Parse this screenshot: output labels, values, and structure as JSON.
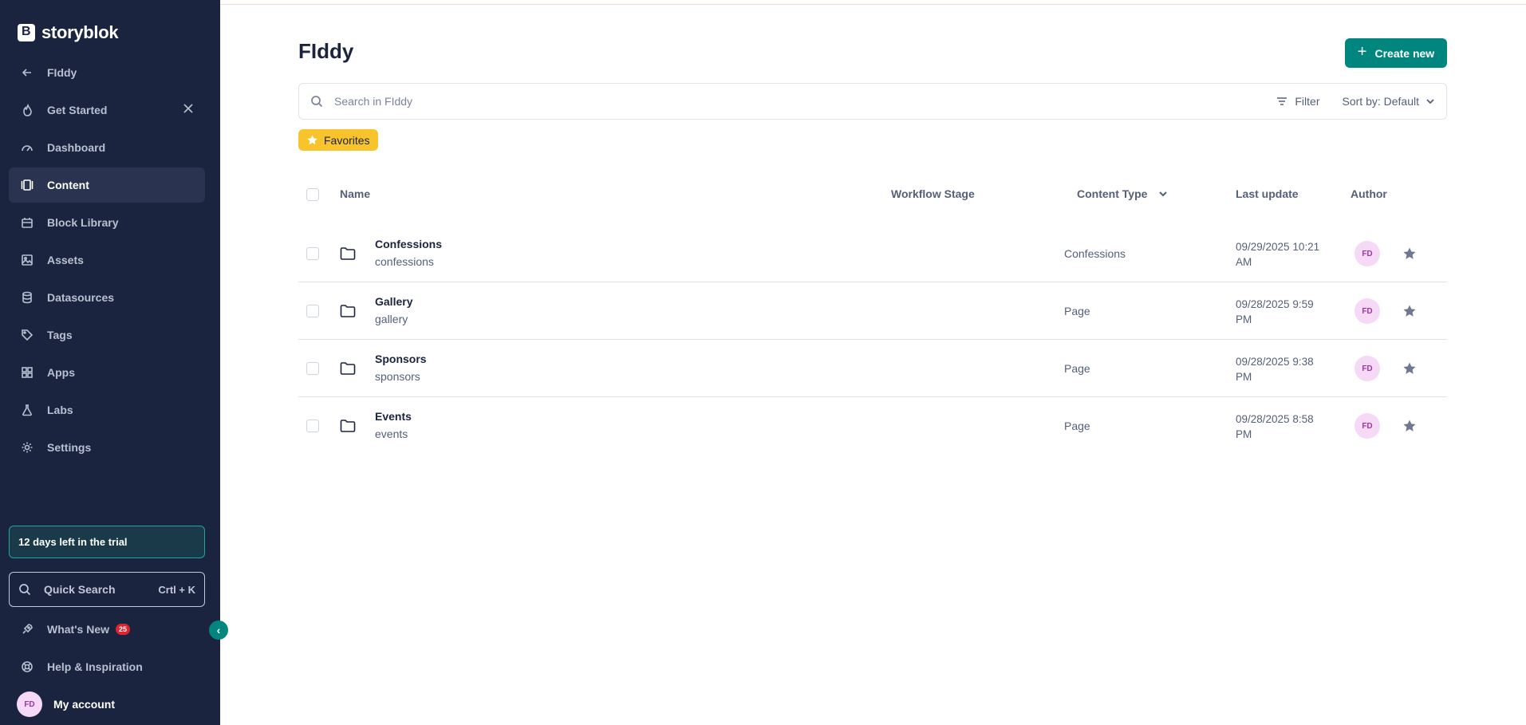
{
  "brand": {
    "name": "storyblok"
  },
  "sidebar": {
    "back_label": "FIddy",
    "items": [
      {
        "label": "Get Started",
        "icon": "flame-icon"
      },
      {
        "label": "Dashboard",
        "icon": "gauge-icon"
      },
      {
        "label": "Content",
        "icon": "content-icon",
        "active": true
      },
      {
        "label": "Block Library",
        "icon": "block-library-icon"
      },
      {
        "label": "Assets",
        "icon": "image-icon"
      },
      {
        "label": "Datasources",
        "icon": "database-icon"
      },
      {
        "label": "Tags",
        "icon": "tag-icon"
      },
      {
        "label": "Apps",
        "icon": "apps-grid-icon"
      },
      {
        "label": "Labs",
        "icon": "flask-icon"
      },
      {
        "label": "Settings",
        "icon": "gear-icon"
      }
    ],
    "trial_text": "12 days left in the trial",
    "quick_search": {
      "label": "Quick Search",
      "shortcut": "Crtl + K"
    },
    "whats_new": {
      "label": "What's New",
      "badge": "25"
    },
    "help_label": "Help & Inspiration",
    "account": {
      "initials": "FD",
      "label": "My account"
    }
  },
  "main": {
    "title": "FIddy",
    "create_label": "Create new",
    "search_placeholder": "Search in FIddy",
    "filter_label": "Filter",
    "sort_label": "Sort by: Default",
    "favorites_label": "Favorites",
    "columns": {
      "name": "Name",
      "workflow": "Workflow Stage",
      "content_type": "Content Type",
      "last_update": "Last update",
      "author": "Author"
    },
    "rows": [
      {
        "name": "Confessions",
        "slug": "confessions",
        "content_type": "Confessions",
        "updated_date": "09/29/2025 10:21",
        "updated_time": "AM",
        "author": "FD"
      },
      {
        "name": "Gallery",
        "slug": "gallery",
        "content_type": "Page",
        "updated_date": "09/28/2025 9:59",
        "updated_time": "PM",
        "author": "FD"
      },
      {
        "name": "Sponsors",
        "slug": "sponsors",
        "content_type": "Page",
        "updated_date": "09/28/2025 9:38",
        "updated_time": "PM",
        "author": "FD"
      },
      {
        "name": "Events",
        "slug": "events",
        "content_type": "Page",
        "updated_date": "09/28/2025 8:58",
        "updated_time": "PM",
        "author": "FD"
      }
    ]
  },
  "colors": {
    "sidebar_bg": "#1b243f",
    "accent": "#00867f",
    "favorites": "#f8c32b",
    "badge": "#e0242f"
  }
}
